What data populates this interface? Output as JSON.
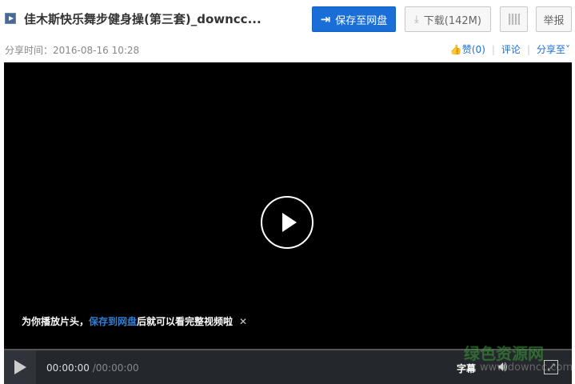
{
  "header": {
    "title": "佳木斯快乐舞步健身操(第三套)_downcc...",
    "save_button": "保存至网盘",
    "download_button": "下载(142M)",
    "report_button": "举报"
  },
  "meta": {
    "share_time_label": "分享时间：",
    "share_time": "2016-08-16 10:28"
  },
  "actions": {
    "like": "赞(0)",
    "comment": "评论",
    "share": "分享至"
  },
  "player": {
    "tip_prefix": "为你播放片头，",
    "tip_link": "保存到网盘",
    "tip_suffix": "后就可以看完整视频啦",
    "current_time": "00:00:00",
    "total_time": "/00:00:00",
    "subtitles": "字幕"
  },
  "watermark": {
    "name": "绿色资源网",
    "url": "www.downcc.com"
  }
}
